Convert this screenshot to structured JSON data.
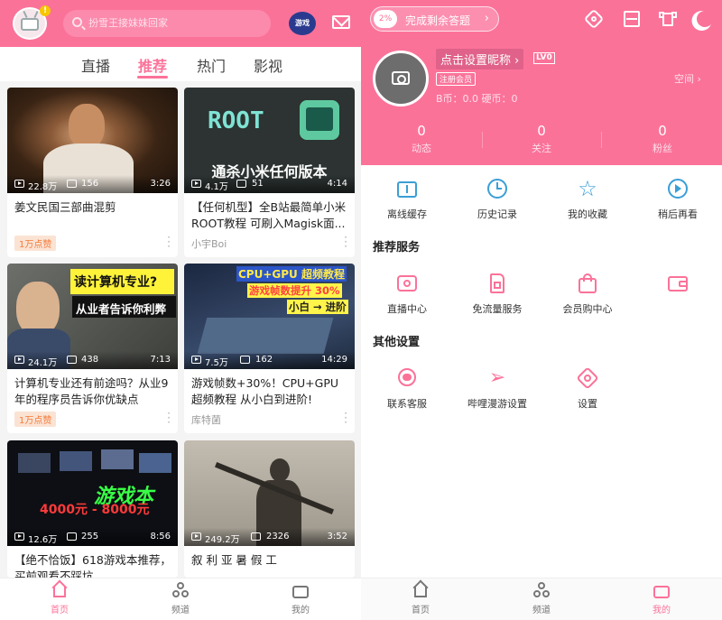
{
  "left": {
    "search": {
      "placeholder": "扮雪王接妹妹回家"
    },
    "notif_dot": "!",
    "game_badge": "游戏",
    "tabs": [
      {
        "label": "直播"
      },
      {
        "label": "推荐"
      },
      {
        "label": "热门"
      },
      {
        "label": "影视"
      }
    ],
    "cards": [
      {
        "views": "22.8万",
        "danmaku": "156",
        "duration": "3:26",
        "title": "姜文民国三部曲混剪",
        "badge": "1万点赞",
        "author": "",
        "overlay": ""
      },
      {
        "views": "4.1万",
        "danmaku": "51",
        "duration": "4:14",
        "title": "【任何机型】全B站最简单小米ROOT教程 可刷入Magisk面...",
        "badge": "",
        "author": "小宇Boi",
        "overlay": "ROOT",
        "overlay2": "通杀小米任何版本"
      },
      {
        "views": "24.1万",
        "danmaku": "438",
        "duration": "7:13",
        "title": "计算机专业还有前途吗？从业9年的程序员告诉你优缺点",
        "badge": "1万点赞",
        "author": "",
        "overlay": "读计算机专业?",
        "overlay2": "从业者告诉你利弊"
      },
      {
        "views": "7.5万",
        "danmaku": "162",
        "duration": "14:29",
        "title": "游戏帧数+30%！CPU+GPU超频教程 从小白到进阶!",
        "badge": "",
        "author": "库特菌",
        "overlay": "CPU+GPU 超频教程",
        "overlay2": "游戏帧数提升 30%",
        "overlay3": "小白 → 进阶"
      },
      {
        "views": "12.6万",
        "danmaku": "255",
        "duration": "8:56",
        "title": "【绝不恰饭】618游戏本推荐，买前观看不踩坑",
        "badge": "",
        "author": "",
        "overlay": "游戏本",
        "overlay2": "4000元 - 8000元"
      },
      {
        "views": "249.2万",
        "danmaku": "2326",
        "duration": "3:52",
        "title": "叙 利 亚 暑 假 工",
        "badge": "",
        "author": "",
        "overlay": ""
      }
    ],
    "bottom_nav": [
      {
        "label": "首页"
      },
      {
        "label": "频道"
      },
      {
        "label": "我的"
      }
    ]
  },
  "right": {
    "quiz": {
      "percent": "2%",
      "label": "完成剩余答题"
    },
    "profile": {
      "nickname": "点击设置昵称",
      "level": "LV0",
      "member": "注册会员",
      "coins": "B币：0.0    硬币：0",
      "space": "空间"
    },
    "stats": [
      {
        "value": "0",
        "label": "动态"
      },
      {
        "value": "0",
        "label": "关注"
      },
      {
        "value": "0",
        "label": "粉丝"
      }
    ],
    "quick": [
      {
        "label": "离线缓存"
      },
      {
        "label": "历史记录"
      },
      {
        "label": "我的收藏"
      },
      {
        "label": "稍后再看"
      }
    ],
    "recommend_title": "推荐服务",
    "services": [
      {
        "label": "直播中心"
      },
      {
        "label": "免流量服务"
      },
      {
        "label": "会员购中心"
      },
      {
        "label": ""
      }
    ],
    "other_title": "其他设置",
    "others": [
      {
        "label": "联系客服"
      },
      {
        "label": "哔哩漫游设置"
      },
      {
        "label": "设置"
      }
    ],
    "bottom_nav": [
      {
        "label": "首页"
      },
      {
        "label": "频道"
      },
      {
        "label": "我的"
      }
    ]
  },
  "colors": {
    "brand_pink": "#fb7299"
  }
}
